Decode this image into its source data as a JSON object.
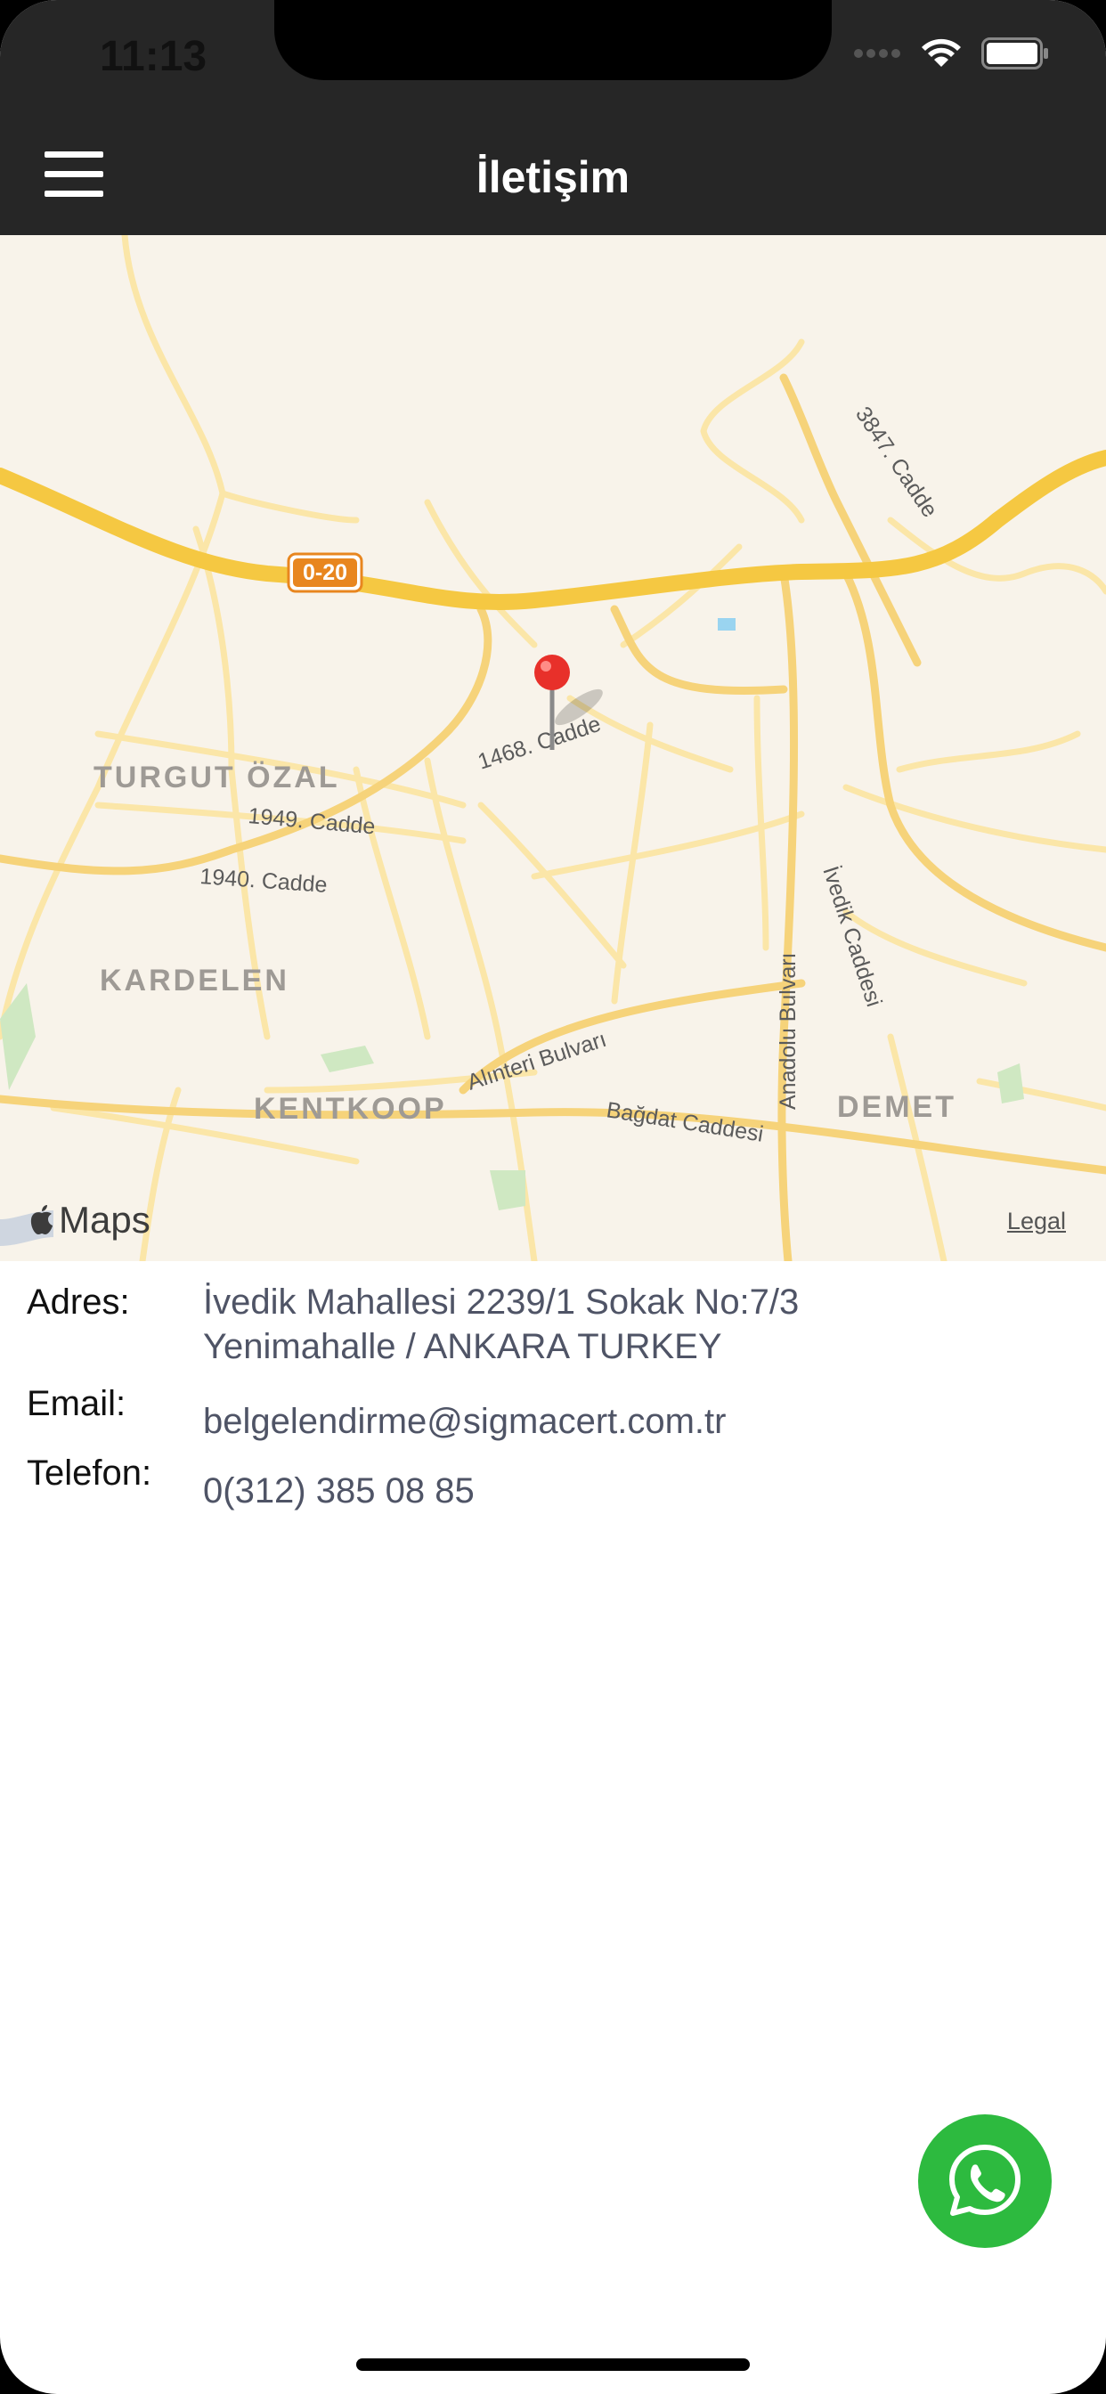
{
  "status": {
    "time": "11:13"
  },
  "nav": {
    "title": "İletişim",
    "menu_icon": "hamburger-menu-icon"
  },
  "map": {
    "attribution": "Maps",
    "legal": "Legal",
    "pin_icon": "map-pin-icon",
    "labels": {
      "road_shield": "0-20",
      "road_3847": "3847. Cadde",
      "road_1468": "1468. Cadde",
      "road_1949": "1949. Cadde",
      "road_1940": "1940. Cadde",
      "road_alinteri": "Alınteri Bulvarı",
      "road_bagdat": "Bağdat Caddesi",
      "road_anadolu": "Anadolu Bulvarı",
      "road_ivedik": "İvedik Caddesi",
      "area_turgut": "TURGUT ÖZAL",
      "area_kardelen": "KARDELEN",
      "area_kentkoop": "KENTKOOP",
      "area_demet": "DEMET"
    }
  },
  "contact": {
    "address_label": "Adres:",
    "address_line1": "İvedik Mahallesi 2239/1 Sokak No:7/3",
    "address_line2": "Yenimahalle / ANKARA TURKEY",
    "email_label": "Email:",
    "email_value": "belgelendirme@sigmacert.com.tr",
    "phone_label": "Telefon:",
    "phone_value": "0(312) 385 08 85"
  },
  "whatsapp": {
    "icon": "whatsapp-icon",
    "color": "#2dba3f"
  },
  "colors": {
    "navbar": "#262626",
    "map_bg": "#f8f3ea",
    "road": "#f5c842",
    "value_text": "#4f5466"
  }
}
